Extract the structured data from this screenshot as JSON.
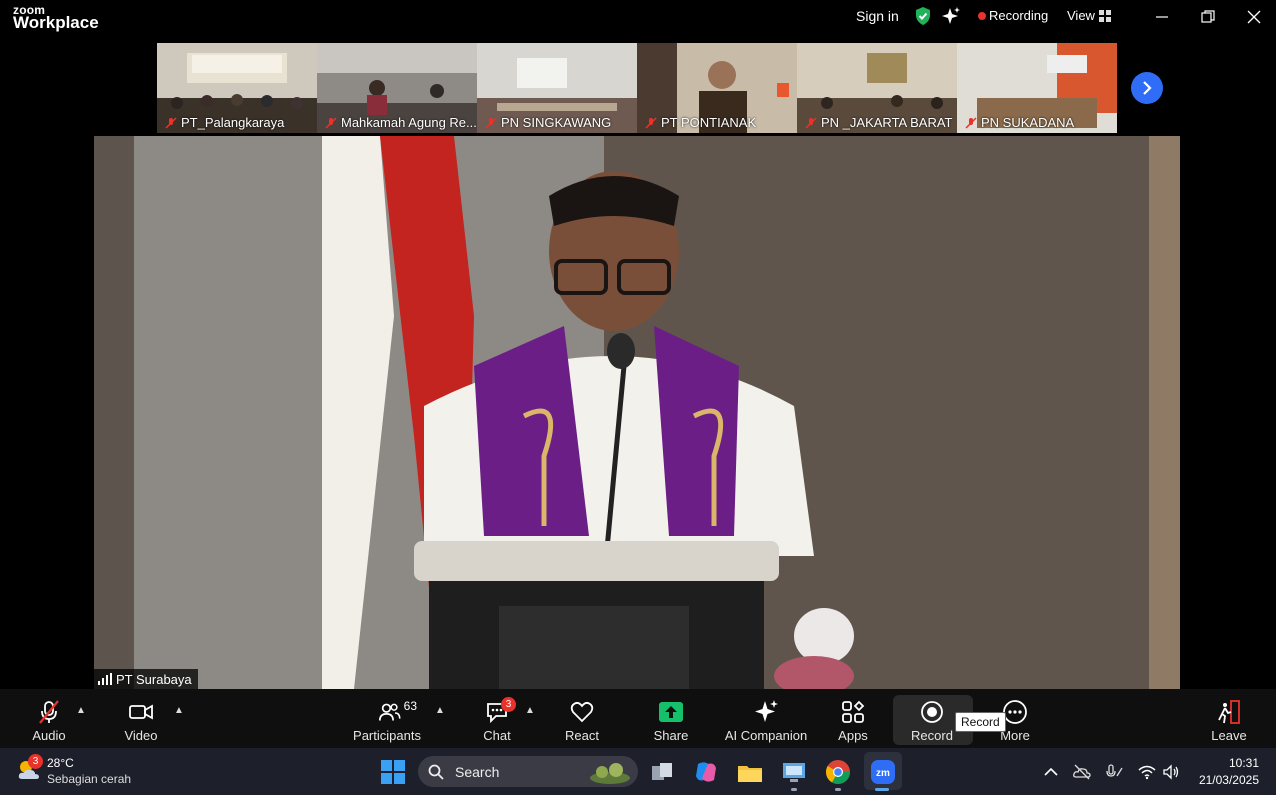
{
  "titlebar": {
    "logo_top": "zoom",
    "logo_main": "Workplace",
    "sign_in": "Sign in",
    "recording": "Recording",
    "view": "View"
  },
  "gallery": {
    "tiles": [
      {
        "name": "PT_Palangkaraya"
      },
      {
        "name": "Mahkamah Agung Re..."
      },
      {
        "name": "PN SINGKAWANG"
      },
      {
        "name": "PT PONTIANAK"
      },
      {
        "name": "PN _JAKARTA BARAT"
      },
      {
        "name": "PN SUKADANA"
      }
    ]
  },
  "main": {
    "speaker_name": "PT Surabaya"
  },
  "toolbar": {
    "audio": "Audio",
    "video": "Video",
    "participants": "Participants",
    "participants_count": "63",
    "chat": "Chat",
    "chat_badge": "3",
    "react": "React",
    "share": "Share",
    "ai_companion": "AI Companion",
    "apps": "Apps",
    "record": "Record",
    "record_tooltip": "Record",
    "more": "More",
    "leave": "Leave"
  },
  "taskbar": {
    "weather_badge": "3",
    "weather_temp": "28°C",
    "weather_desc": "Sebagian cerah",
    "search": "Search",
    "time": "10:31",
    "date": "21/03/2025"
  },
  "colors": {
    "accent_blue": "#2f6df6",
    "recording_red": "#e8322b",
    "share_green": "#16c06a",
    "toolbar_bg": "#0f0f0f",
    "taskbar_bg": "#1d1f2a"
  }
}
